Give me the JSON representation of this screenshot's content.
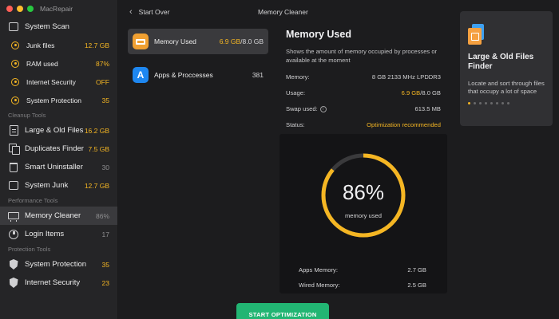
{
  "app": {
    "name": "MacRepair"
  },
  "sidebar": {
    "system_scan": {
      "label": "System Scan"
    },
    "scan_items": [
      {
        "label": "Junk files",
        "value": "12.7 GB"
      },
      {
        "label": "RAM used",
        "value": "87%"
      },
      {
        "label": "Internet Security",
        "value": "OFF"
      },
      {
        "label": "System Protection",
        "value": "35"
      }
    ],
    "cleanup_section": "Cleanup Tools",
    "cleanup_items": [
      {
        "label": "Large & Old Files",
        "value": "16.2 GB",
        "icon": "file-icon"
      },
      {
        "label": "Duplicates Finder",
        "value": "7.5 GB",
        "icon": "duplicates-icon"
      },
      {
        "label": "Smart Uninstaller",
        "value": "30",
        "icon": "trash-icon"
      },
      {
        "label": "System Junk",
        "value": "12.7 GB",
        "icon": "junk-icon"
      }
    ],
    "performance_section": "Performance Tools",
    "performance_items": [
      {
        "label": "Memory Cleaner",
        "value": "86%",
        "icon": "memory-icon"
      },
      {
        "label": "Login Items",
        "value": "17",
        "icon": "login-icon"
      }
    ],
    "protection_section": "Protection Tools",
    "protection_items": [
      {
        "label": "System Protection",
        "value": "35",
        "icon": "shield-icon"
      },
      {
        "label": "Internet Security",
        "value": "23",
        "icon": "shield-icon"
      }
    ]
  },
  "header": {
    "back_label": "Start Over",
    "title": "Memory Cleaner"
  },
  "list": [
    {
      "label": "Memory Used",
      "value_used": "6.9 GB",
      "value_total": "/8.0 GB"
    },
    {
      "label": "Apps & Proccesses",
      "value": "381"
    }
  ],
  "details": {
    "title": "Memory Used",
    "description": "Shows the amount of memory occupied by processes or available at the moment",
    "memory_label": "Memory:",
    "memory_value": "8 GB 2133 MHz  LPDDR3",
    "usage_label": "Usage:",
    "usage_used": "6.9 GB",
    "usage_total": "/8.0 GB",
    "swap_label": "Swap used:",
    "swap_value": "613.5 MB",
    "status_label": "Status:",
    "status_value": "Optimization recommended"
  },
  "gauge": {
    "percent_text": "86%",
    "percent": 86,
    "label": "memory used",
    "apps_label": "Apps Memory:",
    "apps_value": "2.7 GB",
    "wired_label": "Wired Memory:",
    "wired_value": "2.5 GB"
  },
  "start_button": "START OPTIMIZATION",
  "promo": {
    "title": "Large & Old Files Finder",
    "description": "Locate and sort through files that occupy a lot of space",
    "dots_total": 8,
    "dots_active": 1
  },
  "colors": {
    "accent": "#f5b623",
    "button": "#22b573",
    "background": "#1c1c1e"
  }
}
